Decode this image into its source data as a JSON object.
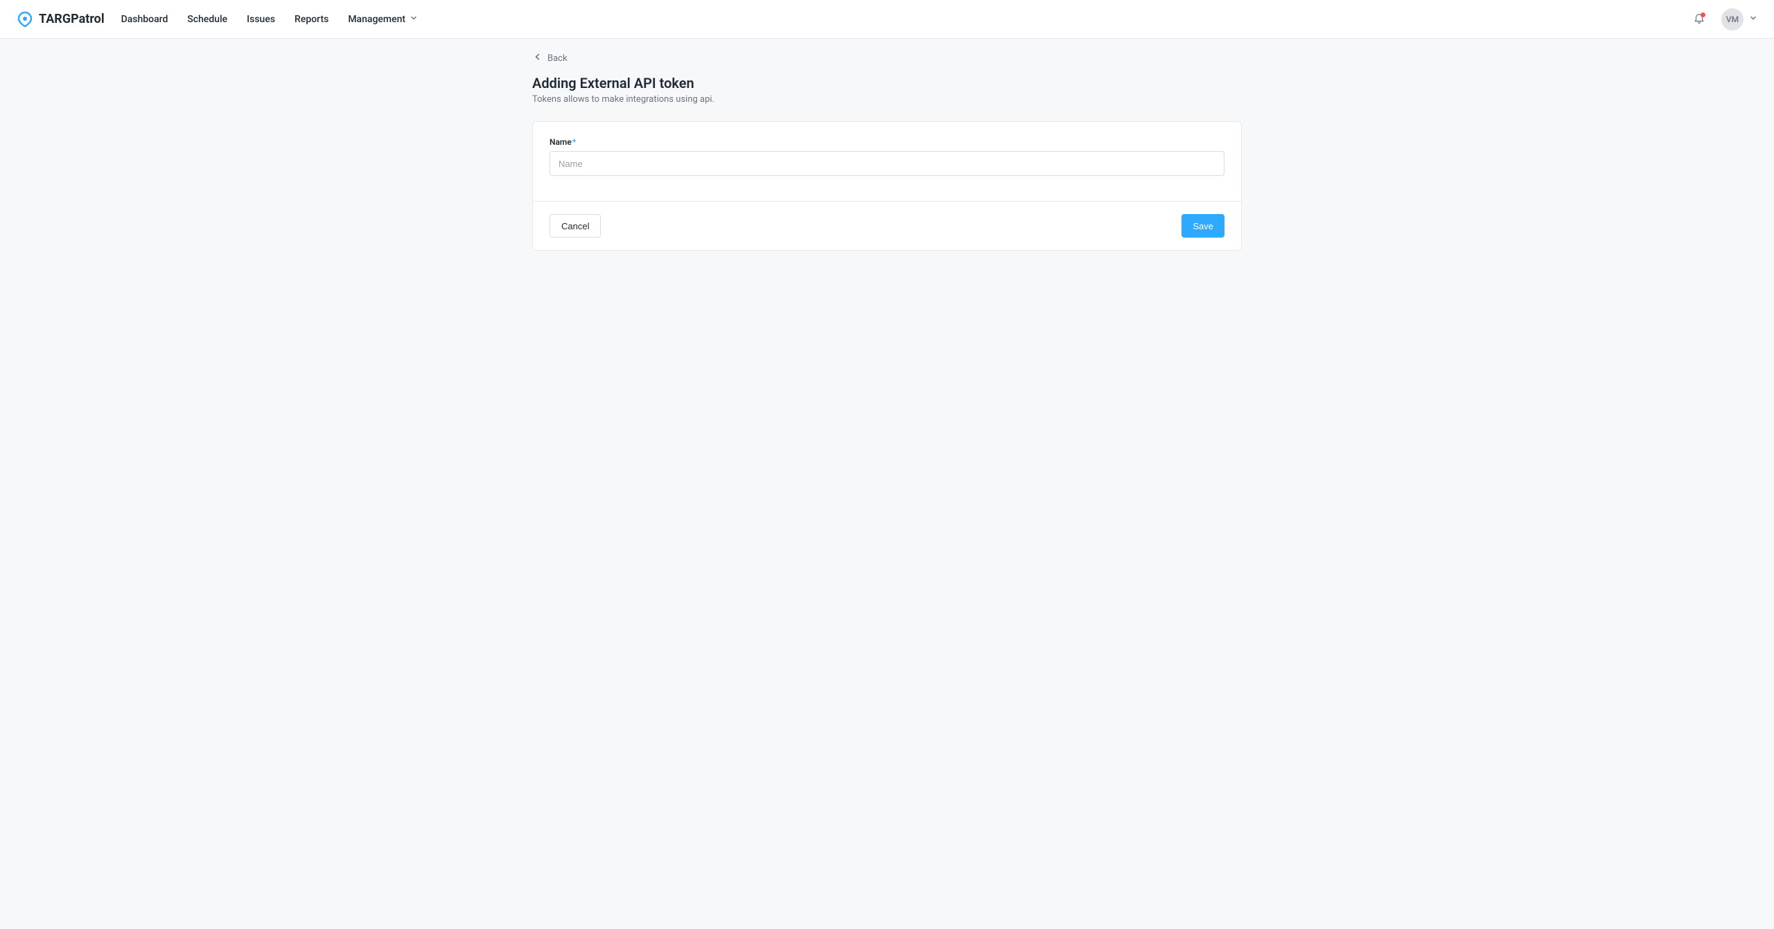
{
  "header": {
    "logo_text": "TARGPatrol",
    "nav": {
      "dashboard": "Dashboard",
      "schedule": "Schedule",
      "issues": "Issues",
      "reports": "Reports",
      "management": "Management"
    },
    "user_initials": "VM"
  },
  "page": {
    "back_label": "Back",
    "title": "Adding External API token",
    "subtitle": "Tokens allows to make integrations using api."
  },
  "form": {
    "name_label": "Name",
    "name_placeholder": "Name",
    "name_value": ""
  },
  "actions": {
    "cancel": "Cancel",
    "save": "Save"
  }
}
